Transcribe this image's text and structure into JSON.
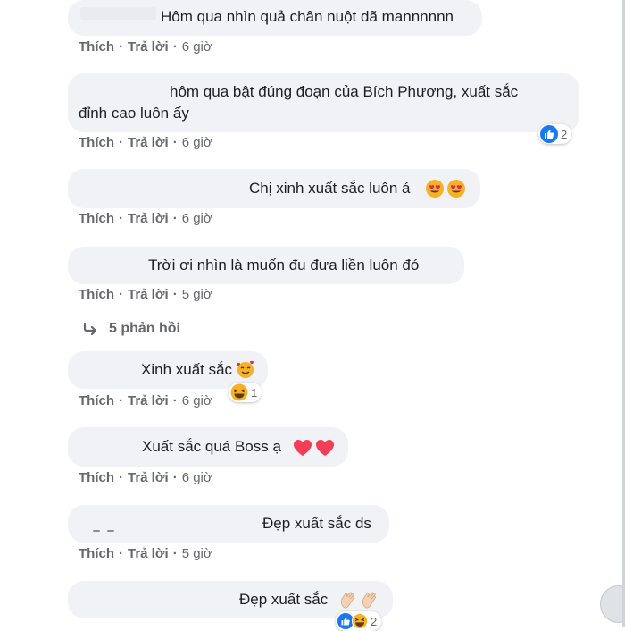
{
  "meta_labels": {
    "like": "Thích",
    "reply": "Trả lời",
    "dot": "·"
  },
  "comments": [
    {
      "text": "Hôm qua nhìn quả chân nuột dã mannnnnn",
      "time": "6 giờ"
    },
    {
      "text_line1": "hôm qua bật đúng đoạn của Bích Phương, xuất sắc",
      "text_line2": "đỉnh cao luôn ấy",
      "time": "6 giờ",
      "reaction_count": "2",
      "reaction_icon": "like-icon"
    },
    {
      "text": "Chị xinh xuất sắc luôn á",
      "time": "6 giờ",
      "emojis": "heart-eyes-icon x2"
    },
    {
      "text": "Trời ơi nhìn là muốn đu đưa liền luôn đó",
      "time": "5 giờ"
    },
    {
      "text": "Xinh xuất sắc",
      "time": "6 giờ",
      "emojis": "smiling-face-with-hearts-icon",
      "reaction_count": "1",
      "reaction_icon": "haha-icon"
    },
    {
      "text": "Xuất sắc quá Boss ạ",
      "time": "6 giờ",
      "emojis": "heart-icon x2"
    },
    {
      "text": "Đẹp xuất sắc ds",
      "time": "5 giờ"
    },
    {
      "text": "Đẹp xuất sắc",
      "emojis": "clap-icon x2",
      "reaction_count": "2",
      "reaction_icon": "like-haha-icon"
    }
  ],
  "replies_link": {
    "label": "5 phản hồi",
    "icon": "reply-arrow-icon"
  },
  "colors": {
    "bubble": "#f0f2f5",
    "meta": "#65676b",
    "like_blue": "#1877f2",
    "heart_red": "#f33e58",
    "haha_yellow": "#f7b125"
  }
}
